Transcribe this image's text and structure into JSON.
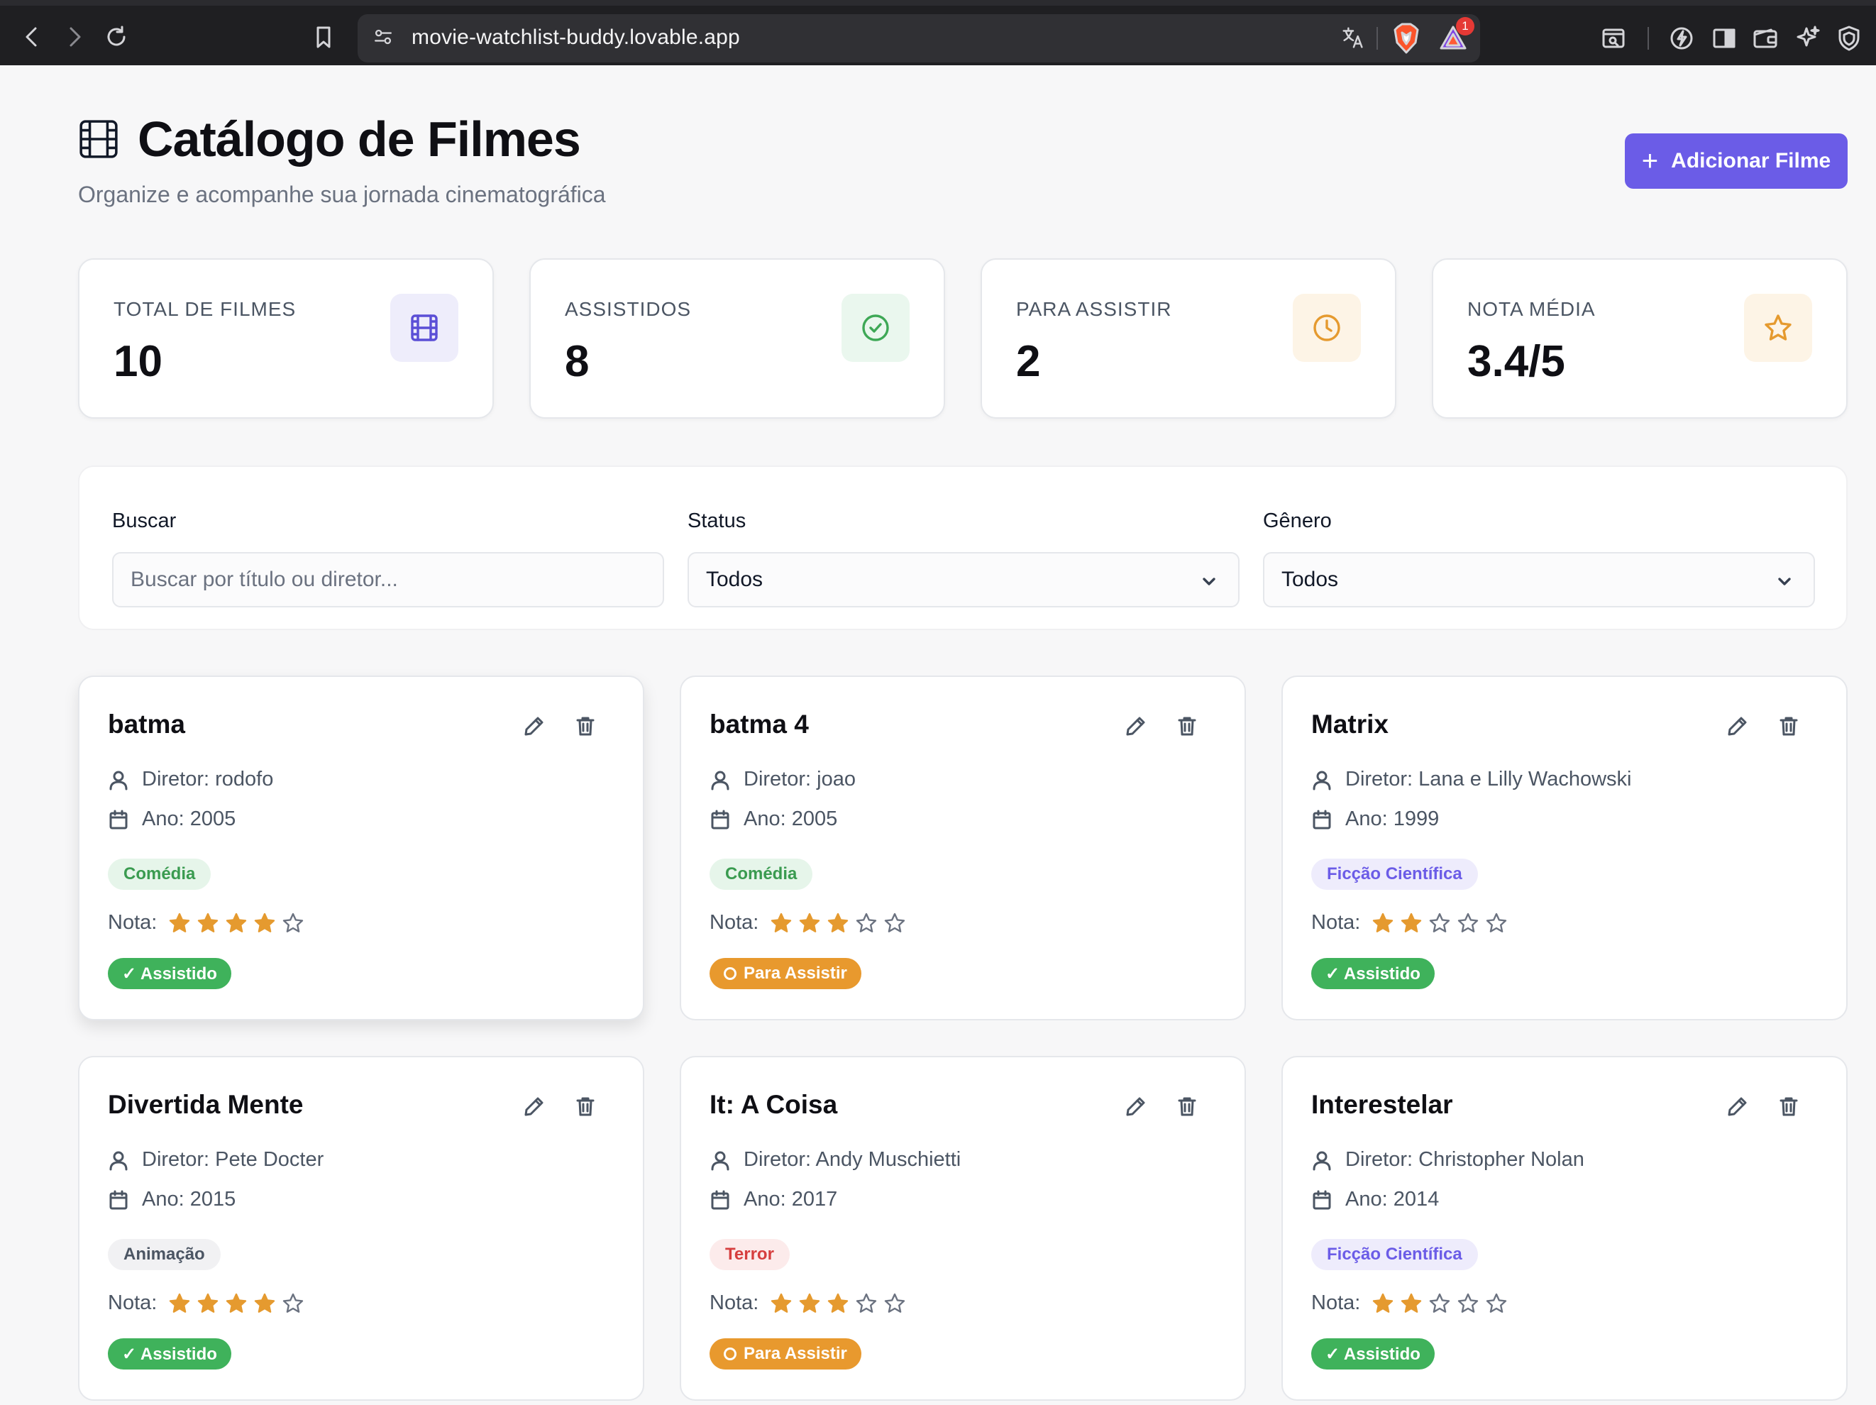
{
  "browser": {
    "url": "movie-watchlist-buddy.lovable.app",
    "notification_count": "1"
  },
  "header": {
    "title": "Catálogo de Filmes",
    "subtitle": "Organize e acompanhe sua jornada cinematográfica",
    "add_button": "Adicionar Filme"
  },
  "stats": [
    {
      "label": "TOTAL DE FILMES",
      "value": "10",
      "icon": "film-icon",
      "color": "#5b4fd6",
      "bg": "#eeedfb"
    },
    {
      "label": "ASSISTIDOS",
      "value": "8",
      "icon": "check-circle-icon",
      "color": "#3ea856",
      "bg": "#eaf7ee"
    },
    {
      "label": "PARA ASSISTIR",
      "value": "2",
      "icon": "clock-icon",
      "color": "#e59a2f",
      "bg": "#fdf4e6"
    },
    {
      "label": "NOTA MÉDIA",
      "value": "3.4/5",
      "icon": "star-icon",
      "color": "#e59a2f",
      "bg": "#fdf4e6"
    }
  ],
  "filters": {
    "search_label": "Buscar",
    "search_placeholder": "Buscar por título ou diretor...",
    "search_value": "",
    "status_label": "Status",
    "status_value": "Todos",
    "genre_label": "Gênero",
    "genre_value": "Todos"
  },
  "labels": {
    "rating": "Nota:"
  },
  "colors": {
    "accent": "#6b5ce7",
    "star": "#e59a2f",
    "watched": "#3fb25b",
    "to_watch": "#e8992e"
  },
  "movies": [
    {
      "title": "batma",
      "director": "Diretor: rodofo",
      "year": "Ano: 2005",
      "genre": "Comédia",
      "genre_fg": "#3a9b50",
      "genre_bg": "#e6f5ea",
      "rating": 4,
      "status": "✓ Assistido",
      "status_kind": "watched"
    },
    {
      "title": "batma 4",
      "director": "Diretor: joao",
      "year": "Ano: 2005",
      "genre": "Comédia",
      "genre_fg": "#3a9b50",
      "genre_bg": "#e6f5ea",
      "rating": 3,
      "status": "Para Assistir",
      "status_kind": "to_watch"
    },
    {
      "title": "Matrix",
      "director": "Diretor: Lana e Lilly Wachowski",
      "year": "Ano: 1999",
      "genre": "Ficção Científica",
      "genre_fg": "#6b5ce7",
      "genre_bg": "#eeecfc",
      "rating": 2,
      "status": "✓ Assistido",
      "status_kind": "watched"
    },
    {
      "title": "Divertida Mente",
      "director": "Diretor: Pete Docter",
      "year": "Ano: 2015",
      "genre": "Animação",
      "genre_fg": "#4b5563",
      "genre_bg": "#f1f1f3",
      "rating": 4,
      "status": "✓ Assistido",
      "status_kind": "watched"
    },
    {
      "title": "It: A Coisa",
      "director": "Diretor: Andy Muschietti",
      "year": "Ano: 2017",
      "genre": "Terror",
      "genre_fg": "#d63e3e",
      "genre_bg": "#fcebeb",
      "rating": 3,
      "status": "Para Assistir",
      "status_kind": "to_watch"
    },
    {
      "title": "Interestelar",
      "director": "Diretor: Christopher Nolan",
      "year": "Ano: 2014",
      "genre": "Ficção Científica",
      "genre_fg": "#6b5ce7",
      "genre_bg": "#eeecfc",
      "rating": 2,
      "status": "✓ Assistido",
      "status_kind": "watched"
    }
  ]
}
